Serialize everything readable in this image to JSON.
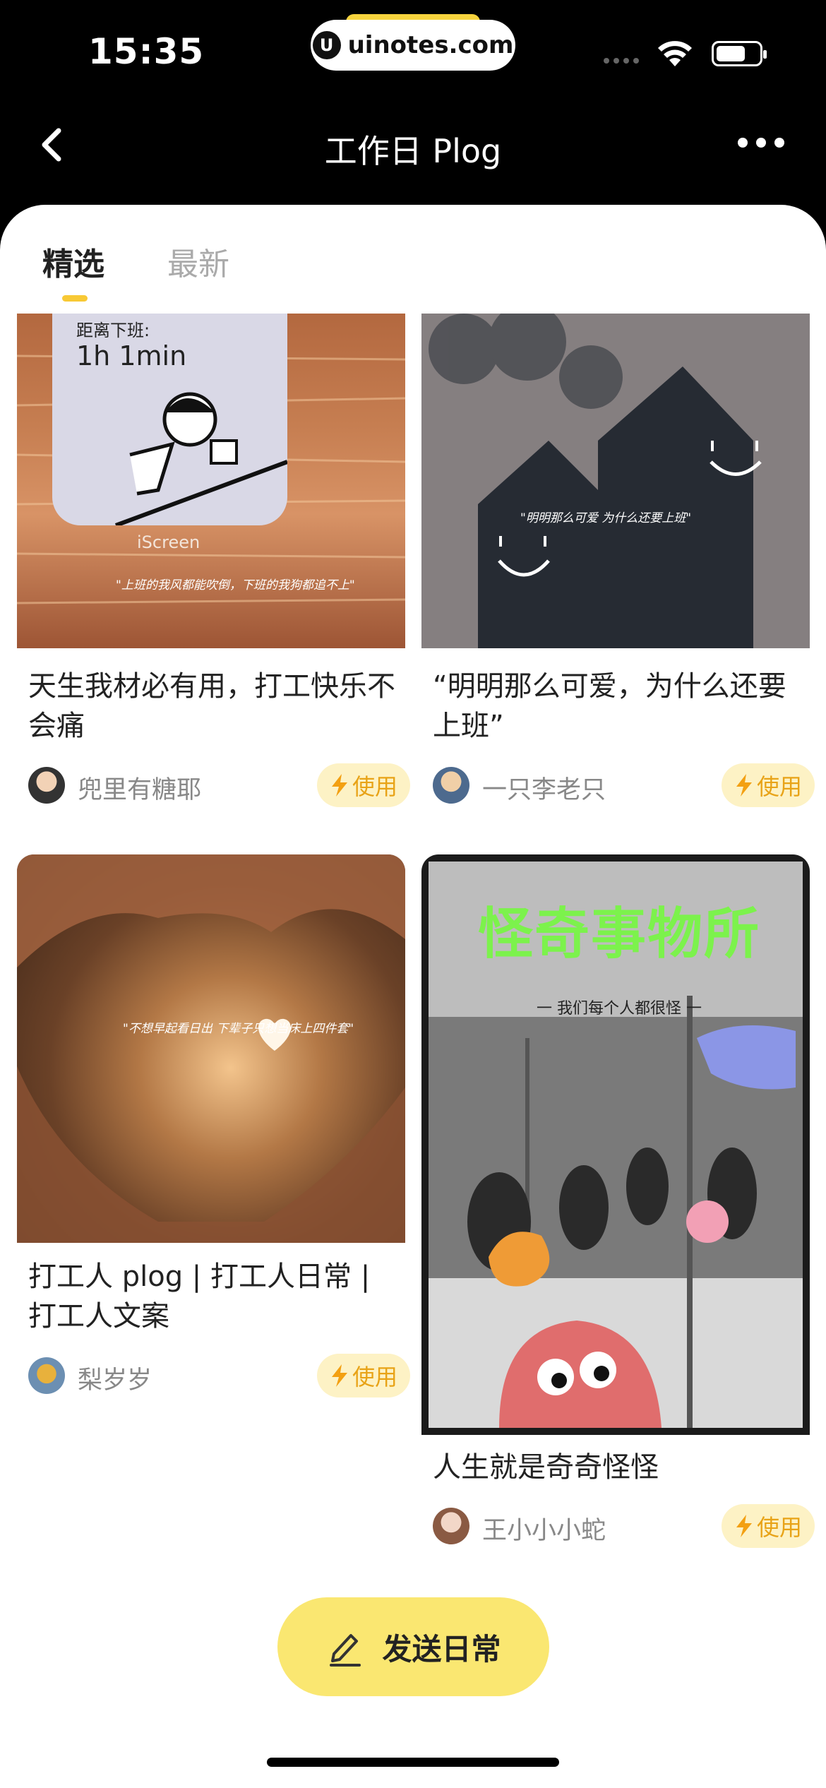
{
  "status": {
    "time": "15:35",
    "watermark": "uinotes.com"
  },
  "nav": {
    "title": "工作日 Plog"
  },
  "tabs": [
    {
      "label": "精选"
    },
    {
      "label": "最新"
    }
  ],
  "cards": [
    {
      "title": "天生我材必有用，打工快乐不会痛",
      "author": "兜里有糖耶",
      "use_label": "使用",
      "image": {
        "widget_label": "距离下班:",
        "widget_time": "1h 1min",
        "widget_app": "iScreen",
        "caption": "\"上班的我风都能吹倒，下班的我狗都追不上\""
      }
    },
    {
      "title": "“明明那么可爱，为什么还要上班”",
      "author": "一只李老只",
      "use_label": "使用",
      "image": {
        "caption": "\"明明那么可爱 为什么还要上班\""
      }
    },
    {
      "title": "打工人 plog | 打工人日常 | 打工人文案",
      "author": "梨岁岁",
      "use_label": "使用",
      "image": {
        "caption": "\"不想早起看日出 下辈子只想当床上四件套\""
      }
    },
    {
      "title": "人生就是奇奇怪怪",
      "author": "王小小小蛇",
      "use_label": "使用",
      "image": {
        "headline": "怪奇事物所",
        "subline": "一 我们每个人都很怪 一"
      }
    }
  ],
  "send_button": {
    "label": "发送日常"
  }
}
